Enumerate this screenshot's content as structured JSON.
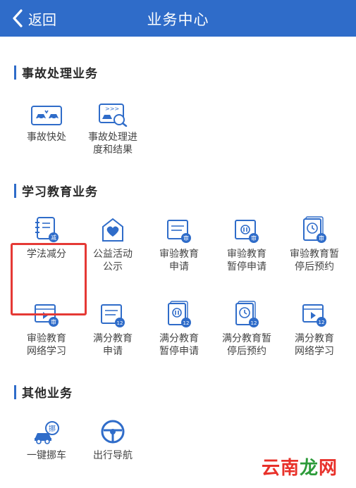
{
  "header": {
    "back_label": "返回",
    "title": "业务中心"
  },
  "sections": [
    {
      "title": "事故处理业务",
      "items": [
        {
          "label_lines": [
            "事故快处"
          ],
          "icon": "car-collision-icon"
        },
        {
          "label_lines": [
            "事故处理进",
            "度和结果"
          ],
          "icon": "accident-progress-search-icon"
        }
      ]
    },
    {
      "title": "学习教育业务",
      "items": [
        {
          "label_lines": [
            "学法减分"
          ],
          "icon": "study-reduce-points-icon"
        },
        {
          "label_lines": [
            "公益活动",
            "公示"
          ],
          "icon": "charity-heart-hand-icon"
        },
        {
          "label_lines": [
            "审验教育",
            "申请"
          ],
          "icon": "audit-education-apply-icon"
        },
        {
          "label_lines": [
            "审验教育",
            "暂停申请"
          ],
          "icon": "audit-education-pause-icon"
        },
        {
          "label_lines": [
            "审验教育暂",
            "停后预约"
          ],
          "icon": "audit-education-reserve-icon"
        },
        {
          "label_lines": [
            "审验教育",
            "网络学习"
          ],
          "icon": "audit-education-online-icon"
        },
        {
          "label_lines": [
            "满分教育",
            "申请"
          ],
          "icon": "full-score-apply-icon"
        },
        {
          "label_lines": [
            "满分教育",
            "暂停申请"
          ],
          "icon": "full-score-pause-icon"
        },
        {
          "label_lines": [
            "满分教育暂",
            "停后预约"
          ],
          "icon": "full-score-reserve-icon"
        },
        {
          "label_lines": [
            "满分教育",
            "网络学习"
          ],
          "icon": "full-score-online-icon"
        }
      ]
    },
    {
      "title": "其他业务",
      "items": [
        {
          "label_lines": [
            "一键挪车"
          ],
          "icon": "move-car-icon"
        },
        {
          "label_lines": [
            "出行导航"
          ],
          "icon": "steering-wheel-navigation-icon"
        }
      ]
    }
  ],
  "badges": {
    "reduce": "减",
    "audit": "审",
    "twelve": "12",
    "move": "挪"
  },
  "watermark": {
    "part1": "云南",
    "part2": "龙",
    "part3": "网"
  },
  "colors": {
    "header_bg": "#2f6cc9",
    "icon_blue": "#2f6cc9",
    "highlight": "#e53935",
    "watermark_red": "#e8312a",
    "watermark_green": "#2d9b3a"
  }
}
